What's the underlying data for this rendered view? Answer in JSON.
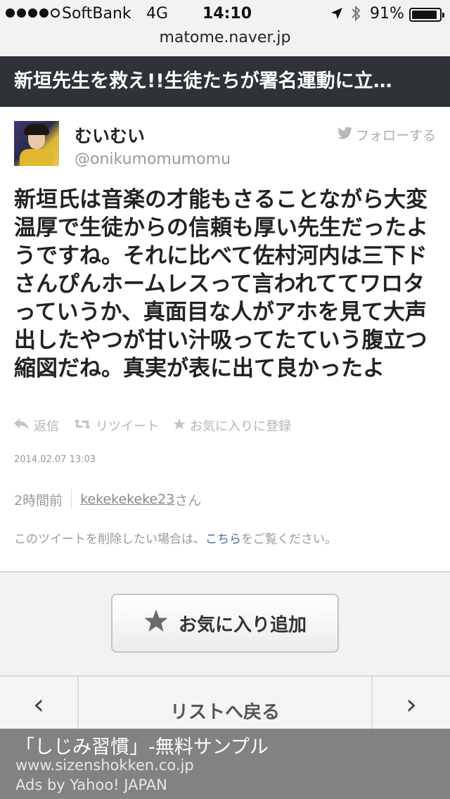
{
  "status_bar": {
    "signal_dots": 5,
    "carrier": "SoftBank",
    "network": "4G",
    "time": "14:10",
    "battery_percent": "91%",
    "battery_level": 0.91
  },
  "url_bar": {
    "domain": "matome.naver.jp"
  },
  "page_title": "新垣先生を救え!!生徒たちが署名運動に立…",
  "tweet": {
    "user_name": "むいむい",
    "user_handle": "@onikumomumomu",
    "follow_label": "フォローする",
    "text": "新垣氏は音楽の才能もさることながら大変温厚で生徒からの信頼も厚い先生だったようですね。それに比べて佐村河内は三下ドさんぴんホームレスって言われててワロタっていうか、真面目な人がアホを見て大声出したやつが甘い汁吸ってたていう腹立つ縮図だね。真実が表に出て良かったよ",
    "actions": {
      "reply": "返信",
      "retweet": "リツイート",
      "favorite": "お気に入りに登録"
    },
    "date": "2014.02.07 13:03"
  },
  "meta": {
    "time_ago": "2時間前",
    "curator": "kekekekeke23",
    "curator_suffix": "さん"
  },
  "delete_note": {
    "prefix": "このツイートを削除したい場合は、",
    "link": "こちら",
    "suffix": "をご覧ください。"
  },
  "fav_button": {
    "label": "お気に入り追加"
  },
  "nav": {
    "prev": "‹",
    "back_to_list": "リストへ戻る",
    "next": "›"
  },
  "ad": {
    "title": "「しじみ習慣」-無料サンプル",
    "url": "www.sizenshokken.co.jp",
    "by": "Ads by Yahoo! JAPAN"
  }
}
